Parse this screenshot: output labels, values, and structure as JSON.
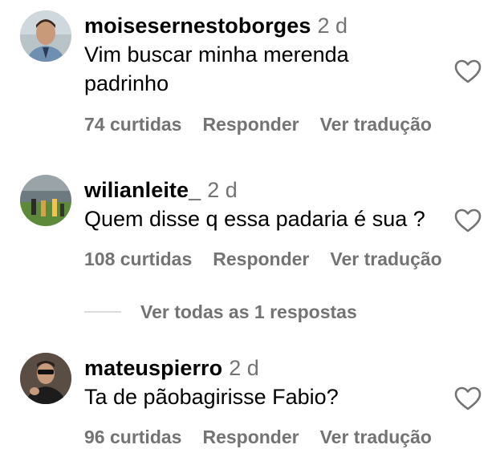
{
  "comments": [
    {
      "username": "moisesernestoborges",
      "time": "2 d",
      "text_lines": [
        "Vim buscar minha merenda",
        "padrinho"
      ],
      "likes": "74 curtidas",
      "reply_label": "Responder",
      "translate_label": "Ver tradução"
    },
    {
      "username": "wilianleite_",
      "time": "2 d",
      "text_lines": [
        "Quem disse q essa padaria é sua ?"
      ],
      "likes": "108 curtidas",
      "reply_label": "Responder",
      "translate_label": "Ver tradução"
    },
    {
      "username": "mateuspierro",
      "time": "2 d",
      "text_lines": [
        "Ta de pãobagirisse Fabio?"
      ],
      "likes": "96 curtidas",
      "reply_label": "Responder",
      "translate_label": "Ver tradução"
    }
  ],
  "replies": {
    "label": "Ver todas as 1 respostas"
  },
  "icons": {
    "like": "heart-outline-icon"
  },
  "colors": {
    "secondary_text": "#737373",
    "divider": "#dbdbdb"
  }
}
